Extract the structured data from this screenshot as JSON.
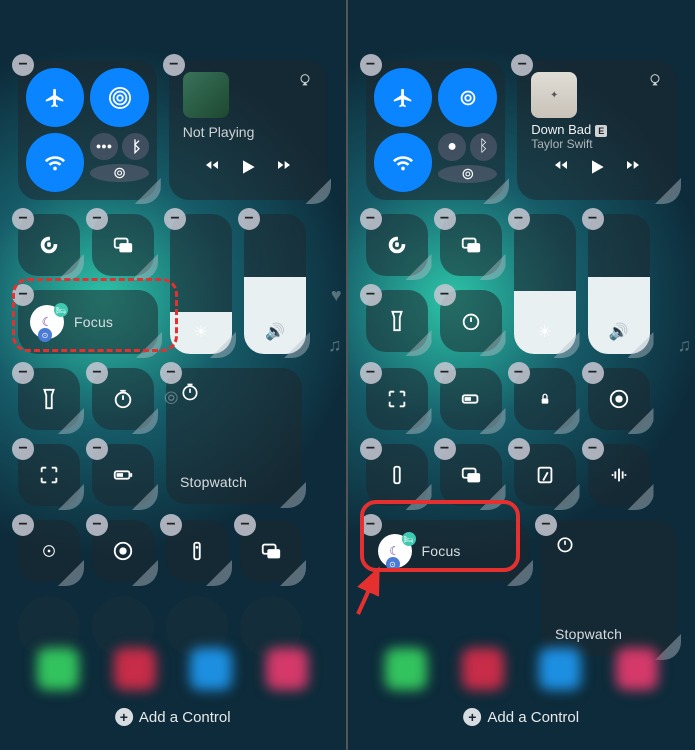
{
  "left": {
    "media": {
      "status": "Not Playing"
    },
    "focus": {
      "label": "Focus"
    },
    "stopwatch": {
      "label": "Stopwatch"
    },
    "add_control": "Add a Control",
    "brightness_pct": 30,
    "volume_pct": 55
  },
  "right": {
    "media": {
      "title": "Down Bad",
      "artist": "Taylor Swift",
      "explicit": "E"
    },
    "focus": {
      "label": "Focus"
    },
    "stopwatch": {
      "label": "Stopwatch"
    },
    "add_control": "Add a Control",
    "brightness_pct": 45,
    "volume_pct": 55
  },
  "colors": {
    "accent": "#0a84ff",
    "highlight": "#e5302f"
  }
}
